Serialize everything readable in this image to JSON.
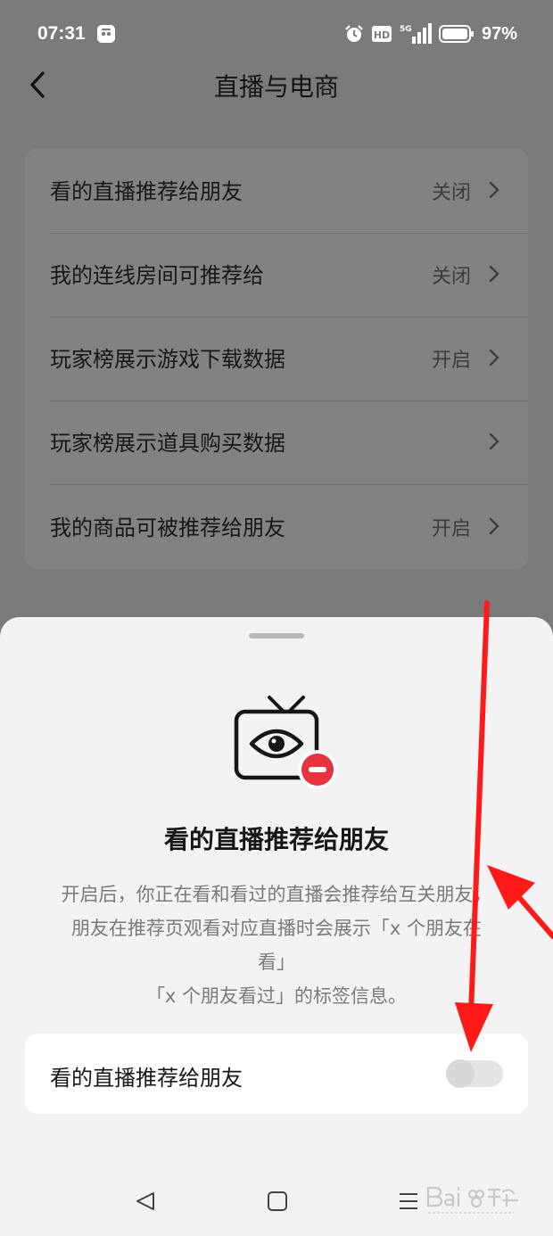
{
  "status_bar": {
    "time": "07:31",
    "network": "5G",
    "hd_label": "HD",
    "battery": "97%",
    "icons": [
      "app-notification-icon",
      "alarm-icon",
      "hd-icon",
      "signal-icon",
      "battery-icon"
    ]
  },
  "header": {
    "title": "直播与电商",
    "back_icon": "chevron-left-icon"
  },
  "settings": [
    {
      "label": "看的直播推荐给朋友",
      "value": "关闭"
    },
    {
      "label": "我的连线房间可推荐给",
      "value": "关闭"
    },
    {
      "label": "玩家榜展示游戏下载数据",
      "value": "开启"
    },
    {
      "label": "玩家榜展示道具购买数据",
      "value": ""
    },
    {
      "label": "我的商品可被推荐给朋友",
      "value": "开启"
    }
  ],
  "sheet": {
    "icon": "tv-eye-minus-icon",
    "title": "看的直播推荐给朋友",
    "description_lines": [
      "开启后，你正在看和看过的直播会推荐给互关朋友，",
      "朋友在推荐页观看对应直播时会展示「x 个朋友在",
      "看」",
      "「x 个朋友看过」的标签信息。"
    ],
    "toggle_label": "看的直播推荐给朋友",
    "toggle_on": false
  },
  "nav": {
    "icons": [
      "nav-back-icon",
      "nav-home-icon",
      "nav-menu-icon"
    ]
  },
  "colors": {
    "accent_red": "#e8323f",
    "annotation_red": "#ff1a1a",
    "sheet_bg": "#f3f3f3",
    "dim_overlay": "#7b7b7b"
  }
}
